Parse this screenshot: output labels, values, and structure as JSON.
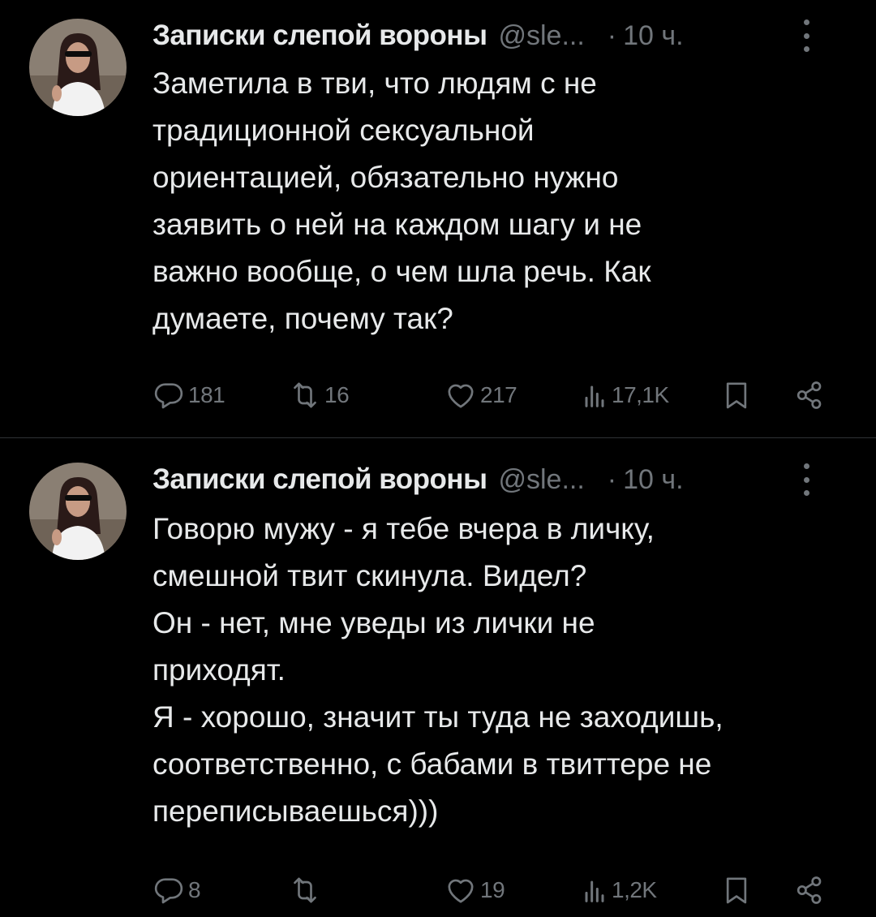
{
  "tweets": [
    {
      "author_name": "Записки слепой вороны",
      "handle": "@sle...",
      "separator": "·",
      "time": "10 ч.",
      "text_lines": [
        "Заметила в тви, что людям с не",
        "традиционной сексуальной",
        "ориентацией, обязательно нужно",
        "заявить о ней на каждом шагу и не",
        "важно вообще, о чем шла речь. Как",
        "думаете, почему так?"
      ],
      "replies": "181",
      "retweets": "16",
      "likes": "217",
      "views": "17,1K"
    },
    {
      "author_name": "Записки слепой вороны",
      "handle": "@sle...",
      "separator": "·",
      "time": "10 ч.",
      "text_lines": [
        "Говорю мужу - я тебе вчера в личку,",
        "смешной твит скинула. Видел?",
        "Он - нет, мне уведы из лички не",
        "приходят.",
        "Я - хорошо, значит ты туда не заходишь,",
        "соответственно, с бабами в твиттере не",
        "переписываешься)))"
      ],
      "replies": "8",
      "retweets": "",
      "likes": "19",
      "views": "1,2K"
    }
  ],
  "icons": {
    "reply": "reply-icon",
    "retweet": "retweet-icon",
    "like": "heart-icon",
    "views": "views-bar-chart-icon",
    "bookmark": "bookmark-icon",
    "share": "share-icon",
    "more": "more-vertical-icon"
  },
  "colors": {
    "background": "#000000",
    "text": "#e7e9ea",
    "secondary": "#71767b",
    "divider": "#2f3336"
  }
}
